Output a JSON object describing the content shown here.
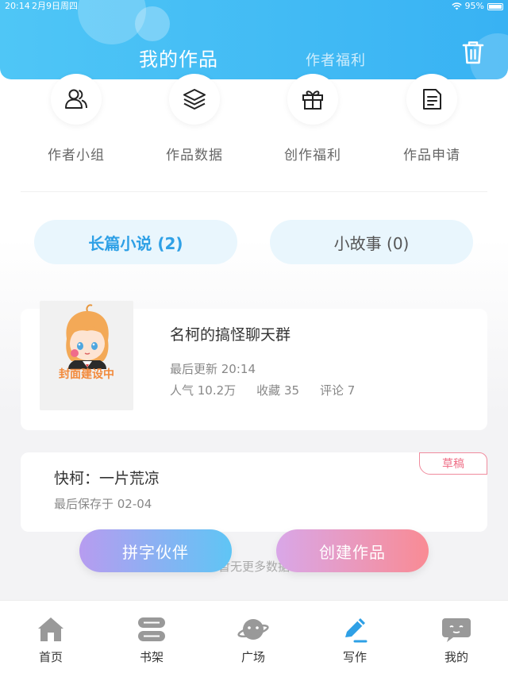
{
  "status_bar": {
    "time": "20:14",
    "date": "2月9日周四",
    "battery": "95%"
  },
  "header": {
    "tab_mine": "我的作品",
    "tab_welfare": "作者福利"
  },
  "quick_actions": [
    {
      "label": "作者小组",
      "icon": "group-icon"
    },
    {
      "label": "作品数据",
      "icon": "layers-icon"
    },
    {
      "label": "创作福利",
      "icon": "gift-icon"
    },
    {
      "label": "作品申请",
      "icon": "document-icon"
    }
  ],
  "categories": {
    "long": "长篇小说 (2)",
    "short": "小故事 (0)"
  },
  "work": {
    "cover_text": "封面建设中",
    "title": "名柯的搞怪聊天群",
    "update": "最后更新 20:14",
    "popularity": "人气 10.2万",
    "favorites": "收藏 35",
    "comments": "评论 7"
  },
  "draft": {
    "badge": "草稿",
    "title": "快柯：一片荒凉",
    "saved": "最后保存于 02-04"
  },
  "no_more": "暂无更多数据",
  "buttons": {
    "partner": "拼字伙伴",
    "create": "创建作品"
  },
  "bottom_nav": [
    {
      "label": "首页",
      "icon": "home-icon"
    },
    {
      "label": "书架",
      "icon": "bookshelf-icon"
    },
    {
      "label": "广场",
      "icon": "planet-icon"
    },
    {
      "label": "写作",
      "icon": "pen-icon"
    },
    {
      "label": "我的",
      "icon": "chat-bubble-icon"
    }
  ],
  "colors": {
    "header": "#38b2f3",
    "active_tab": "#2ea0e6",
    "draft": "#ef6f87",
    "nav_active": "#2ea0e6"
  }
}
